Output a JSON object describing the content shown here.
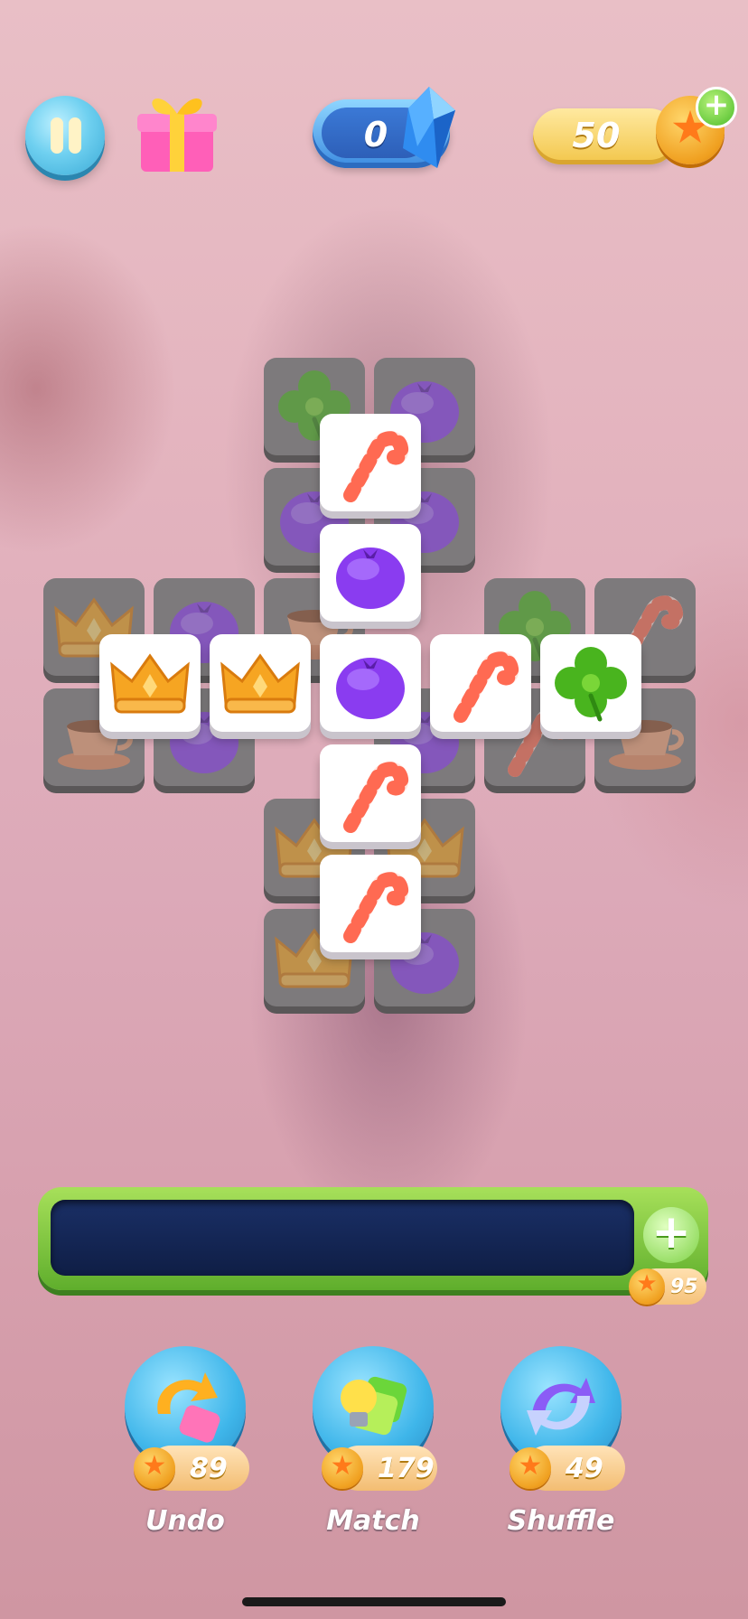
{
  "hud": {
    "gems": "0",
    "coins": "50"
  },
  "board": {
    "tiles_bottom": [
      {
        "icon": "clover-icon"
      },
      {
        "icon": "blueberry-icon"
      },
      {
        "icon": "blueberry-icon"
      },
      {
        "icon": "blueberry-icon"
      },
      {
        "icon": "crown-icon"
      },
      {
        "icon": "blueberry-icon"
      },
      {
        "icon": "teacup-icon"
      },
      {
        "icon": "clover-icon"
      },
      {
        "icon": "candy-cane-icon"
      },
      {
        "icon": "teacup-icon"
      },
      {
        "icon": "blueberry-icon"
      },
      {
        "icon": "blueberry-icon"
      },
      {
        "icon": "candy-cane-icon"
      },
      {
        "icon": "teacup-icon"
      },
      {
        "icon": "crown-icon"
      },
      {
        "icon": "crown-icon"
      },
      {
        "icon": "crown-icon"
      },
      {
        "icon": "blueberry-icon"
      }
    ],
    "tiles_top": [
      {
        "icon": "candy-cane-icon"
      },
      {
        "icon": "blueberry-icon"
      },
      {
        "icon": "crown-icon"
      },
      {
        "icon": "crown-icon"
      },
      {
        "icon": "blueberry-icon"
      },
      {
        "icon": "candy-cane-icon"
      },
      {
        "icon": "clover-icon"
      },
      {
        "icon": "candy-cane-icon"
      },
      {
        "icon": "candy-cane-icon"
      }
    ]
  },
  "tray": {
    "add_slot_cost": "95"
  },
  "boosters": [
    {
      "label": "Undo",
      "cost": "89",
      "icon": "undo-icon"
    },
    {
      "label": "Match",
      "cost": "179",
      "icon": "match-lightbulb-icon"
    },
    {
      "label": "Shuffle",
      "cost": "49",
      "icon": "shuffle-icon"
    }
  ],
  "colors": {
    "tray_green": "#7ed246",
    "tray_slot": "#142657",
    "booster_blue": "#3fb6ea",
    "coin_gold": "#f0a020"
  }
}
